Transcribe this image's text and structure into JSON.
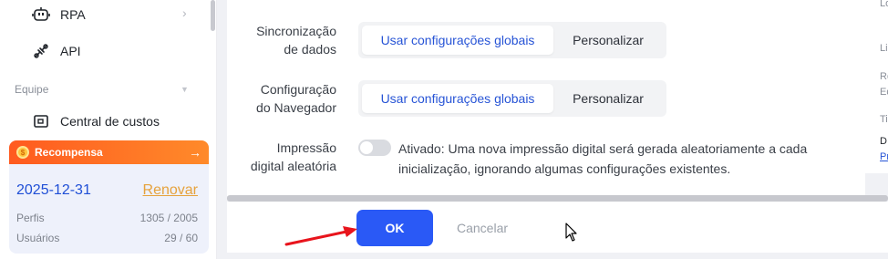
{
  "sidebar": {
    "items": [
      {
        "label": "RPA",
        "icon": "robot-icon"
      },
      {
        "label": "API",
        "icon": "plug-icon"
      },
      {
        "label": "Central de custos",
        "icon": "cost-center-icon"
      }
    ],
    "section_label": "Equipe"
  },
  "reward": {
    "title": "Recompensa",
    "date": "2025-12-31",
    "renew_label": "Renovar",
    "profiles_label": "Perfis",
    "profiles_value": "1305 / 2005",
    "users_label": "Usuários",
    "users_value": "29 / 60"
  },
  "form": {
    "sync_label_1": "Sincronização",
    "sync_label_2": "de dados",
    "sync_global": "Usar configurações globais",
    "sync_custom": "Personalizar",
    "browser_label_1": "Configuração",
    "browser_label_2": "do Navegador",
    "browser_global": "Usar configurações globais",
    "browser_custom": "Personalizar",
    "fingerprint_label_1": "Impressão",
    "fingerprint_label_2": "digital aleatória",
    "fingerprint_desc": "Ativado: Uma nova impressão digital será gerada aleatoriamente a cada inicialização, ignorando algumas configurações existentes."
  },
  "footer": {
    "ok_label": "OK",
    "cancel_label": "Cancelar"
  },
  "right_panel": {
    "t1": "Lo",
    "t2": "Li",
    "t3": "Re",
    "t4": "Ed",
    "t5": "Ti",
    "t6": "D",
    "t7": "Pr"
  },
  "colors": {
    "primary": "#2a59f6",
    "accent_orange": "#ff6a21",
    "renew": "#e6a23c"
  }
}
